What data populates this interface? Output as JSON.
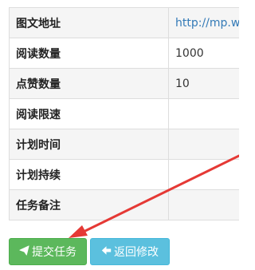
{
  "rows": [
    {
      "label": "图文地址",
      "value": "http://mp.w"
    },
    {
      "label": "阅读数量",
      "value": "1000"
    },
    {
      "label": "点赞数量",
      "value": "10"
    },
    {
      "label": "阅读限速",
      "value": ""
    },
    {
      "label": "计划时间",
      "value": ""
    },
    {
      "label": "计划持续",
      "value": ""
    },
    {
      "label": "任务备注",
      "value": ""
    }
  ],
  "buttons": {
    "submit_label": "提交任务",
    "back_label": "返回修改",
    "submit_icon": "paper-plane-icon",
    "back_icon": "arrow-left-icon"
  },
  "annotation": {
    "arrow_color": "#e53935"
  },
  "colors": {
    "submit": "#5cb85c",
    "back": "#5bc0de",
    "link": "#337ab7"
  }
}
